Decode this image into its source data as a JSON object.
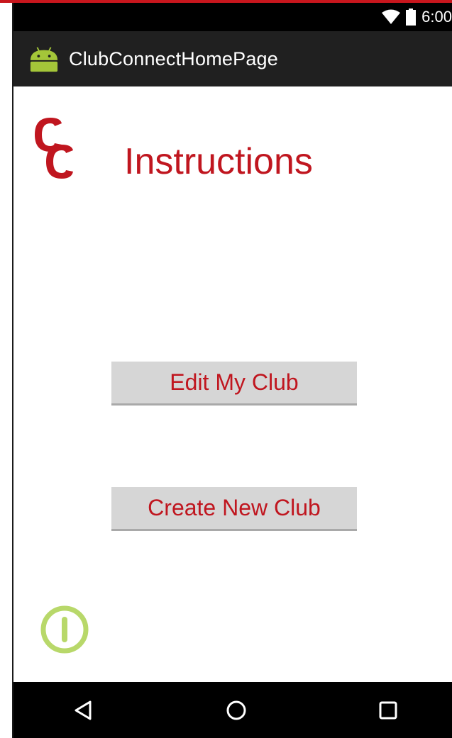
{
  "status_bar": {
    "time": "6:00",
    "wifi_icon": "wifi-icon",
    "battery_icon": "battery-icon"
  },
  "action_bar": {
    "app_icon": "android-icon",
    "title": "ClubConnectHomePage"
  },
  "main": {
    "logo": {
      "text": "CC",
      "icon": "club-connect-logo"
    },
    "heading": "Instructions",
    "buttons": {
      "edit_label": "Edit My Club",
      "create_label": "Create New Club"
    },
    "power_icon": "power-icon"
  },
  "nav_bar": {
    "back_icon": "back-icon",
    "home_icon": "home-icon",
    "recents_icon": "recents-icon"
  },
  "colors": {
    "accent_red": "#c0161f",
    "button_gray": "#d6d6d6",
    "action_bar": "#202020",
    "power_green": "#b8d86a"
  }
}
